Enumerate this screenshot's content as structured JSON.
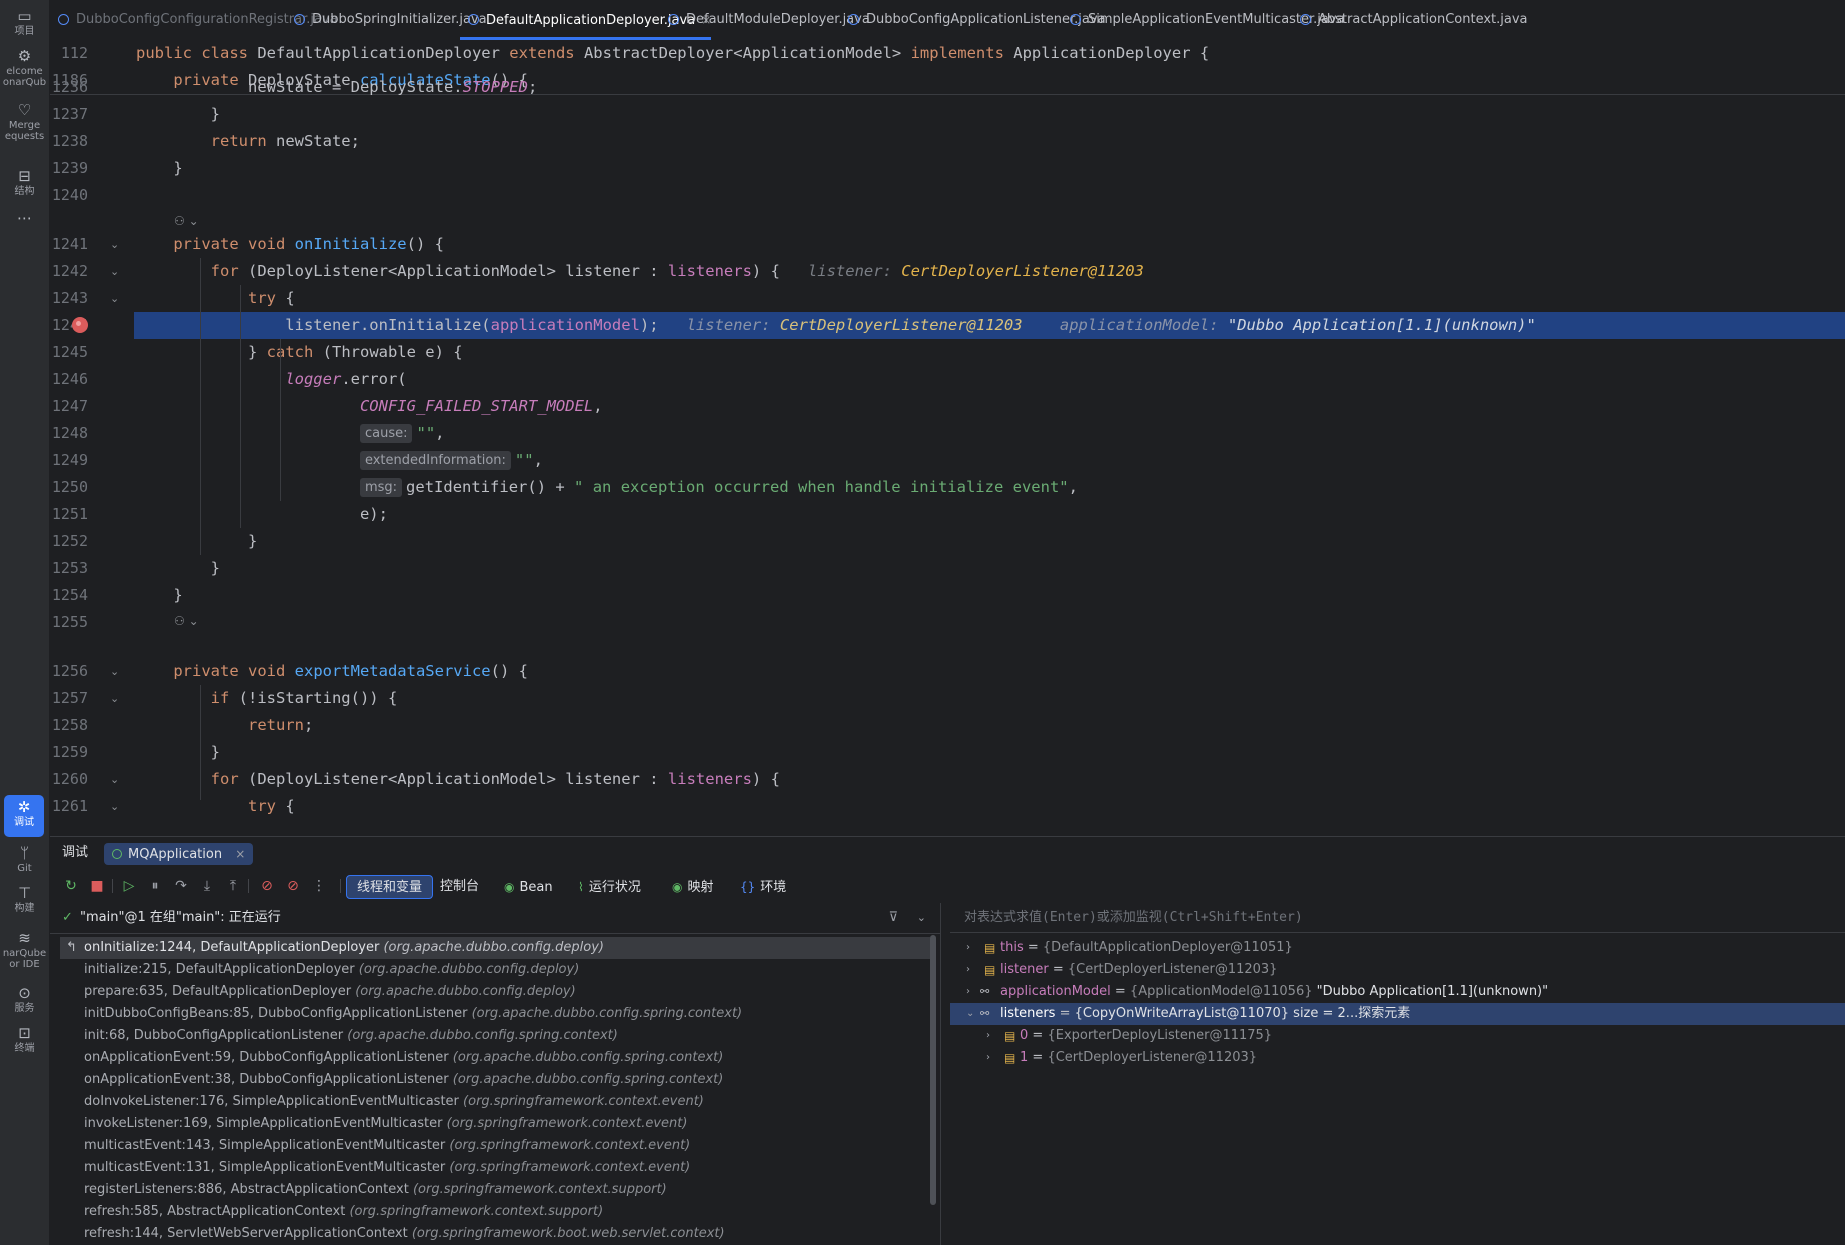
{
  "leftbar": [
    {
      "icon": "folder-icon",
      "glyph": "▭",
      "label": "项目"
    },
    {
      "icon": "welcome-icon",
      "glyph": "⚙",
      "label": "elcome"
    },
    {
      "icon": "sonarqube-icon",
      "glyph": "",
      "label": "onarQub"
    },
    {
      "icon": "merge-requests-icon",
      "glyph": "♡",
      "label": "Merge"
    },
    {
      "icon": "",
      "glyph": "",
      "label": "equests"
    },
    {
      "icon": "structure-icon",
      "glyph": "⊟",
      "label": "结构"
    },
    {
      "icon": "more-icon",
      "glyph": "⋯",
      "label": ""
    },
    {
      "icon": "debug-icon",
      "glyph": "✲",
      "label": "调试"
    },
    {
      "icon": "git-icon",
      "glyph": "ᛘ",
      "label": "Git"
    },
    {
      "icon": "build-icon",
      "glyph": "⊤",
      "label": "构建"
    },
    {
      "icon": "sonarqube-ide-icon",
      "glyph": "≋",
      "label": "narQube"
    },
    {
      "icon": "",
      "glyph": "",
      "label": "or IDE"
    },
    {
      "icon": "services-icon",
      "glyph": "⊙",
      "label": "服务"
    },
    {
      "icon": "terminal-icon",
      "glyph": "⊡",
      "label": "终端"
    }
  ],
  "tabs": [
    {
      "label": "DubboConfigConfigurationRegistrar.java",
      "state": "dim"
    },
    {
      "label": "DubboSpringInitializer.java",
      "state": ""
    },
    {
      "label": "DefaultApplicationDeployer.java",
      "state": "active",
      "close": "×"
    },
    {
      "label": "DefaultModuleDeployer.java",
      "state": ""
    },
    {
      "label": "DubboConfigApplicationListener.java",
      "state": ""
    },
    {
      "label": "SimpleApplicationEventMulticaster.java",
      "state": ""
    },
    {
      "label": "AbstractApplicationContext.java",
      "state": ""
    }
  ],
  "editor": {
    "sticky": [
      {
        "ln": "112",
        "tokens": [
          [
            "kw",
            "public class "
          ],
          [
            "",
            "DefaultApplicationDeployer "
          ],
          [
            "kw",
            "extends "
          ],
          [
            "",
            "AbstractDeployer<ApplicationModel> "
          ],
          [
            "kw",
            "implements "
          ],
          [
            "",
            "ApplicationDeployer {"
          ]
        ]
      },
      {
        "ln": "1186",
        "tokens": [
          [
            "",
            "    "
          ],
          [
            "kw",
            "private "
          ],
          [
            "",
            "DeployState "
          ],
          [
            "fn",
            "calculateState"
          ],
          [
            "",
            "() {"
          ]
        ]
      }
    ],
    "lines": [
      {
        "ln": "1236",
        "tokens": [
          [
            "",
            "            newState = DeployState."
          ],
          [
            "fld it",
            "STOPPED"
          ],
          [
            "",
            ";"
          ]
        ]
      },
      {
        "ln": "1237",
        "tokens": [
          [
            "",
            "        }"
          ]
        ]
      },
      {
        "ln": "1238",
        "tokens": [
          [
            "",
            "        "
          ],
          [
            "kw",
            "return "
          ],
          [
            "",
            "newState;"
          ]
        ]
      },
      {
        "ln": "1239",
        "tokens": [
          [
            "",
            "    }"
          ]
        ]
      },
      {
        "ln": "1240",
        "tokens": []
      },
      {
        "ln": "1241",
        "fold": "⌄",
        "tokens": [
          [
            "",
            "    "
          ],
          [
            "kw",
            "private void "
          ],
          [
            "fn",
            "onInitialize"
          ],
          [
            "",
            "() {"
          ]
        ]
      },
      {
        "ln": "1242",
        "fold": "⌄",
        "tokens": [
          [
            "",
            "        "
          ],
          [
            "kw",
            "for "
          ],
          [
            "",
            "(DeployListener<ApplicationModel> listener : "
          ],
          [
            "fld",
            "listeners"
          ],
          [
            "",
            ") {   "
          ],
          [
            "inl",
            "listener: "
          ],
          [
            "inlv",
            "CertDeployerListener@11203"
          ]
        ]
      },
      {
        "ln": "1243",
        "fold": "⌄",
        "tokens": [
          [
            "",
            "            "
          ],
          [
            "kw",
            "try "
          ],
          [
            "",
            "{"
          ]
        ]
      },
      {
        "ln": "1244",
        "hl": true,
        "bp": true,
        "tokens": [
          [
            "",
            "                listener.onInitialize("
          ],
          [
            "fld",
            "applicationModel"
          ],
          [
            "",
            ");   "
          ],
          [
            "inl",
            "listener: "
          ],
          [
            "inlv",
            "CertDeployerListener@11203"
          ],
          [
            "",
            "    "
          ],
          [
            "inl",
            "applicationModel: "
          ],
          [
            "strv",
            "\"Dubbo Application[1.1](unknown)\""
          ]
        ]
      },
      {
        "ln": "1245",
        "tokens": [
          [
            "",
            "            } "
          ],
          [
            "kw",
            "catch "
          ],
          [
            "",
            "(Throwable e) {"
          ]
        ]
      },
      {
        "ln": "1246",
        "tokens": [
          [
            "",
            "                "
          ],
          [
            "fld it",
            "logger"
          ],
          [
            "",
            ".error("
          ]
        ]
      },
      {
        "ln": "1247",
        "tokens": [
          [
            "",
            "                        "
          ],
          [
            "fld it",
            "CONFIG_FAILED_START_MODEL"
          ],
          [
            "",
            ","
          ]
        ]
      },
      {
        "ln": "1248",
        "tokens": [
          [
            "",
            "                        "
          ],
          [
            "hint",
            "cause:"
          ],
          [
            "str",
            "\"\""
          ],
          [
            "",
            ","
          ]
        ]
      },
      {
        "ln": "1249",
        "tokens": [
          [
            "",
            "                        "
          ],
          [
            "hint",
            "extendedInformation:"
          ],
          [
            "str",
            "\"\""
          ],
          [
            "",
            ","
          ]
        ]
      },
      {
        "ln": "1250",
        "tokens": [
          [
            "",
            "                        "
          ],
          [
            "hint",
            "msg:"
          ],
          [
            "",
            "getIdentifier() + "
          ],
          [
            "str",
            "\" an exception occurred when handle initialize event\""
          ],
          [
            "",
            ","
          ]
        ]
      },
      {
        "ln": "1251",
        "tokens": [
          [
            "",
            "                        e);"
          ]
        ]
      },
      {
        "ln": "1252",
        "tokens": [
          [
            "",
            "            }"
          ]
        ]
      },
      {
        "ln": "1253",
        "tokens": [
          [
            "",
            "        }"
          ]
        ]
      },
      {
        "ln": "1254",
        "tokens": [
          [
            "",
            "    }"
          ]
        ]
      },
      {
        "ln": "1255",
        "tokens": []
      },
      {
        "ln": "1256",
        "fold": "⌄",
        "tokens": [
          [
            "",
            "    "
          ],
          [
            "kw",
            "private void "
          ],
          [
            "fn",
            "exportMetadataService"
          ],
          [
            "",
            "() {"
          ]
        ]
      },
      {
        "ln": "1257",
        "fold": "⌄",
        "tokens": [
          [
            "",
            "        "
          ],
          [
            "kw",
            "if "
          ],
          [
            "",
            "(!isStarting()) {"
          ]
        ]
      },
      {
        "ln": "1258",
        "tokens": [
          [
            "",
            "            "
          ],
          [
            "kw",
            "return"
          ],
          [
            "",
            ";"
          ]
        ]
      },
      {
        "ln": "1259",
        "tokens": [
          [
            "",
            "        }"
          ]
        ]
      },
      {
        "ln": "1260",
        "fold": "⌄",
        "tokens": [
          [
            "",
            "        "
          ],
          [
            "kw",
            "for "
          ],
          [
            "",
            "(DeployListener<ApplicationModel> listener : "
          ],
          [
            "fld",
            "listeners"
          ],
          [
            "",
            ") {"
          ]
        ]
      },
      {
        "ln": "1261",
        "fold": "⌄",
        "tokens": [
          [
            "",
            "            "
          ],
          [
            "kw",
            "try "
          ],
          [
            "",
            "{"
          ]
        ]
      }
    ],
    "lens_glyph": "⚇ ⌄"
  },
  "debug": {
    "panel_title": "调试",
    "run_config": "MQApplication",
    "run_close": "×",
    "toolbar": [
      {
        "name": "rerun-icon",
        "glyph": "↻",
        "cls": "green"
      },
      {
        "name": "stop-icon",
        "glyph": "■",
        "cls": "red"
      },
      {
        "name": "resume-icon",
        "glyph": "▷",
        "cls": "green"
      },
      {
        "name": "pause-icon",
        "glyph": "⏸",
        "cls": ""
      },
      {
        "name": "step-over-icon",
        "glyph": "↷",
        "cls": ""
      },
      {
        "name": "step-into-icon",
        "glyph": "⤓",
        "cls": ""
      },
      {
        "name": "step-out-icon",
        "glyph": "⤒",
        "cls": ""
      },
      {
        "name": "view-breakpoints-icon",
        "glyph": "⊘",
        "cls": "red"
      },
      {
        "name": "mute-breakpoints-icon",
        "glyph": "⊘",
        "cls": "red"
      },
      {
        "name": "more-icon",
        "glyph": "⋮",
        "cls": ""
      }
    ],
    "view_tabs": [
      {
        "name": "threads-variables-tab",
        "label": "线程和变量",
        "icon": "",
        "selected": true
      },
      {
        "name": "console-tab",
        "label": "控制台",
        "icon": ""
      },
      {
        "name": "bean-tab",
        "label": "Bean",
        "icon": "◉"
      },
      {
        "name": "health-tab",
        "label": "运行状况",
        "icon": "⌇"
      },
      {
        "name": "mappings-tab",
        "label": "映射",
        "icon": "◉"
      },
      {
        "name": "environment-tab",
        "label": "环境",
        "icon": "{}"
      }
    ],
    "thread": "\"main\"@1 在组\"main\": 正在运行",
    "frames": [
      {
        "m": "onInitialize:1244, DefaultApplicationDeployer",
        "p": "(org.apache.dubbo.config.deploy)",
        "sel": true
      },
      {
        "m": "initialize:215, DefaultApplicationDeployer",
        "p": "(org.apache.dubbo.config.deploy)"
      },
      {
        "m": "prepare:635, DefaultApplicationDeployer",
        "p": "(org.apache.dubbo.config.deploy)"
      },
      {
        "m": "initDubboConfigBeans:85, DubboConfigApplicationListener",
        "p": "(org.apache.dubbo.config.spring.context)"
      },
      {
        "m": "init:68, DubboConfigApplicationListener",
        "p": "(org.apache.dubbo.config.spring.context)"
      },
      {
        "m": "onApplicationEvent:59, DubboConfigApplicationListener",
        "p": "(org.apache.dubbo.config.spring.context)"
      },
      {
        "m": "onApplicationEvent:38, DubboConfigApplicationListener",
        "p": "(org.apache.dubbo.config.spring.context)"
      },
      {
        "m": "doInvokeListener:176, SimpleApplicationEventMulticaster",
        "p": "(org.springframework.context.event)"
      },
      {
        "m": "invokeListener:169, SimpleApplicationEventMulticaster",
        "p": "(org.springframework.context.event)"
      },
      {
        "m": "multicastEvent:143, SimpleApplicationEventMulticaster",
        "p": "(org.springframework.context.event)"
      },
      {
        "m": "multicastEvent:131, SimpleApplicationEventMulticaster",
        "p": "(org.springframework.context.event)"
      },
      {
        "m": "registerListeners:886, AbstractApplicationContext",
        "p": "(org.springframework.context.support)"
      },
      {
        "m": "refresh:585, AbstractApplicationContext",
        "p": "(org.springframework.context.support)"
      },
      {
        "m": "refresh:144, ServletWebServerApplicationContext",
        "p": "(org.springframework.boot.web.servlet.context)"
      }
    ],
    "expr_placeholder": "对表达式求值(Enter)或添加监视(Ctrl+Shift+Enter)",
    "variables": [
      {
        "name": "this",
        "type": "{DefaultApplicationDeployer@11051}",
        "extra": "",
        "level": 0,
        "arrow": "›",
        "icon": "field",
        "sel": false
      },
      {
        "name": "listener",
        "type": "{CertDeployerListener@11203}",
        "extra": "",
        "level": 0,
        "arrow": "›",
        "icon": "field",
        "sel": false
      },
      {
        "name": "applicationModel",
        "type": "{ApplicationModel@11056}",
        "extra": "\"Dubbo Application[1.1](unknown)\"",
        "level": 0,
        "arrow": "›",
        "icon": "glasses",
        "sel": false
      },
      {
        "name": "listeners",
        "type": "{CopyOnWriteArrayList@11070}",
        "extra": "size = 2...探索元素",
        "level": 0,
        "arrow": "⌄",
        "icon": "glasses",
        "sel": true
      },
      {
        "name": "0",
        "type": "{ExporterDeployListener@11175}",
        "extra": "",
        "level": 1,
        "arrow": "›",
        "icon": "field",
        "sel": false
      },
      {
        "name": "1",
        "type": "{CertDeployerListener@11203}",
        "extra": "",
        "level": 1,
        "arrow": "›",
        "icon": "field",
        "sel": false
      }
    ]
  }
}
